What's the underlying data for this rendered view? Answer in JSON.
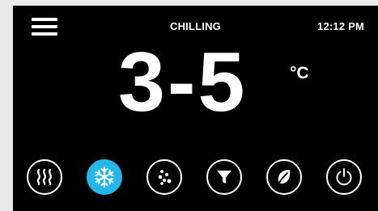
{
  "header": {
    "status": "CHILLING",
    "time": "12:12 PM"
  },
  "temperature": {
    "value": "3-5",
    "unit": "°C"
  },
  "modes": [
    {
      "icon": "heat-icon",
      "active": false
    },
    {
      "icon": "snowflake-icon",
      "active": true
    },
    {
      "icon": "dots-icon",
      "active": false
    },
    {
      "icon": "filter-icon",
      "active": false
    },
    {
      "icon": "leaf-icon",
      "active": false
    },
    {
      "icon": "power-icon",
      "active": false
    }
  ],
  "colors": {
    "background": "#000000",
    "foreground": "#ffffff",
    "accent": "#22b9ea",
    "frame": "#e9e9e9"
  }
}
